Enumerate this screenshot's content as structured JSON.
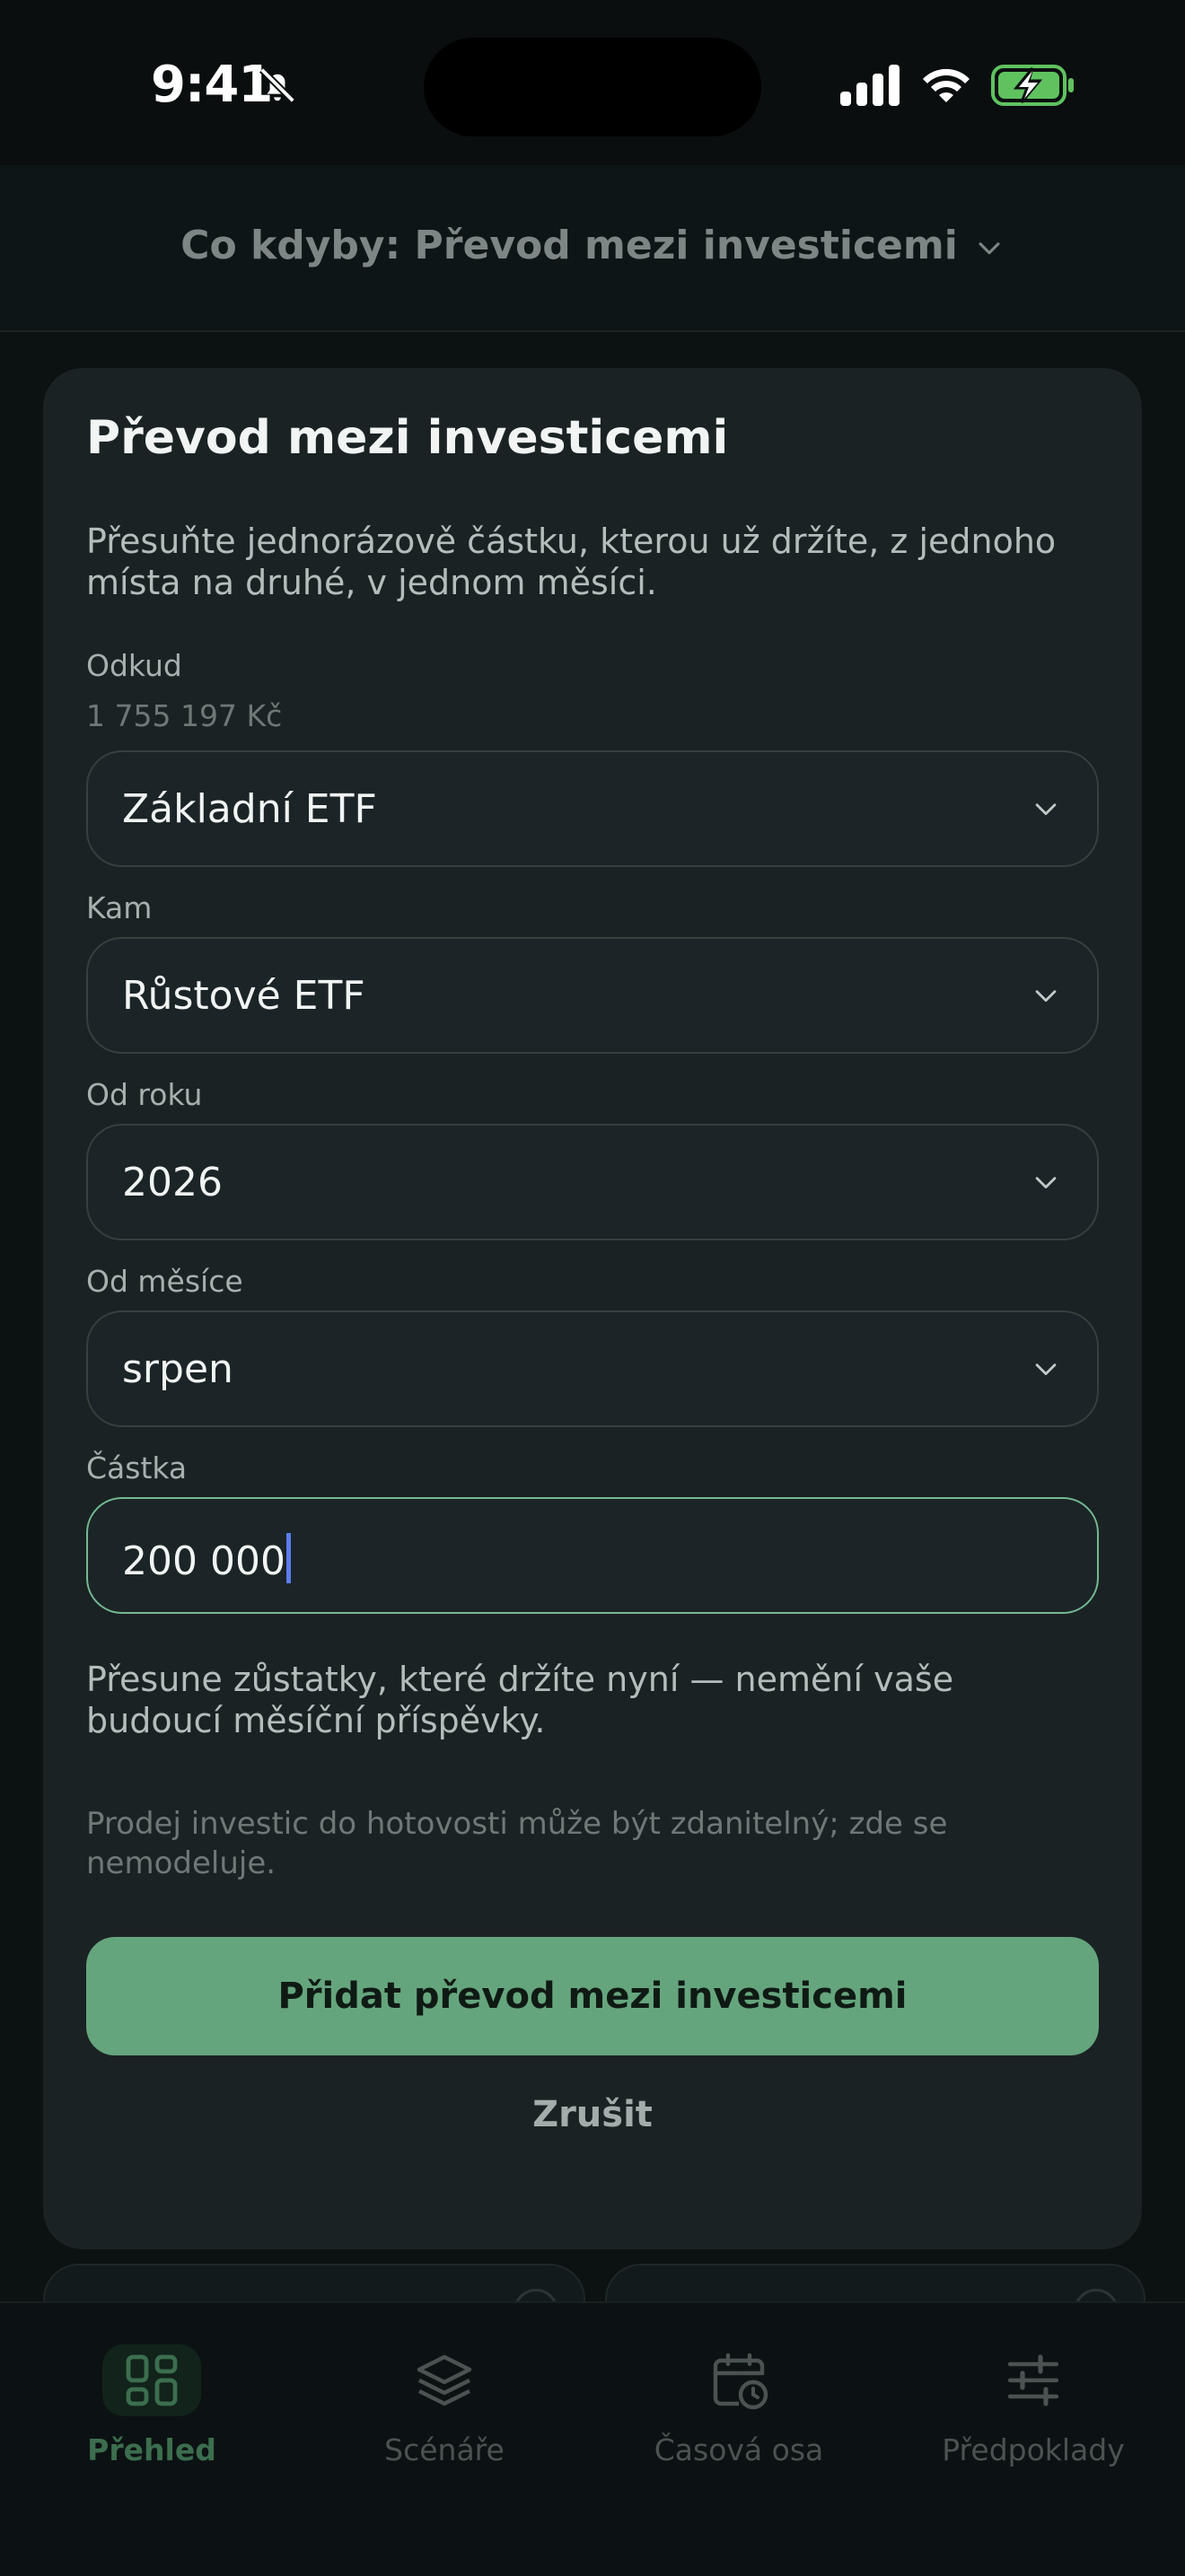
{
  "status_bar": {
    "time": "9:41"
  },
  "top_nav": {
    "title": "Co kdyby: Převod mezi investicemi"
  },
  "sheet": {
    "title": "Převod mezi investicemi",
    "description": "Přesuňte jednorázově částku, kterou už držíte, z jednoho místa na druhé, v jednom měsíci.",
    "from": {
      "label": "Odkud",
      "balance": "1 755 197 Kč",
      "value": "Základní ETF"
    },
    "to": {
      "label": "Kam",
      "value": "Růstové ETF"
    },
    "year": {
      "label": "Od roku",
      "value": "2026"
    },
    "month": {
      "label": "Od měsíce",
      "value": "srpen"
    },
    "amount": {
      "label": "Částka",
      "value": "200 000"
    },
    "note": "Přesune zůstatky, které držíte nyní — nemění vaše budoucí měsíční příspěvky.",
    "tax_note": "Prodej investic do hotovosti může být zdanitelný; zde se nemodeluje.",
    "primary_button": "Přidat převod mezi investicemi",
    "cancel_button": "Zrušit"
  },
  "tab_bar": {
    "tabs": [
      {
        "label": "Přehled",
        "icon": "grid-icon",
        "active": true
      },
      {
        "label": "Scénáře",
        "icon": "layers-icon",
        "active": false
      },
      {
        "label": "Časová osa",
        "icon": "calendar-clock-icon",
        "active": false
      },
      {
        "label": "Předpoklady",
        "icon": "sliders-icon",
        "active": false
      }
    ]
  },
  "colors": {
    "accent": "#65a57d",
    "sheet_bg": "#1a2224",
    "page_bg": "#0c1112",
    "caret": "#5b7cf2"
  }
}
